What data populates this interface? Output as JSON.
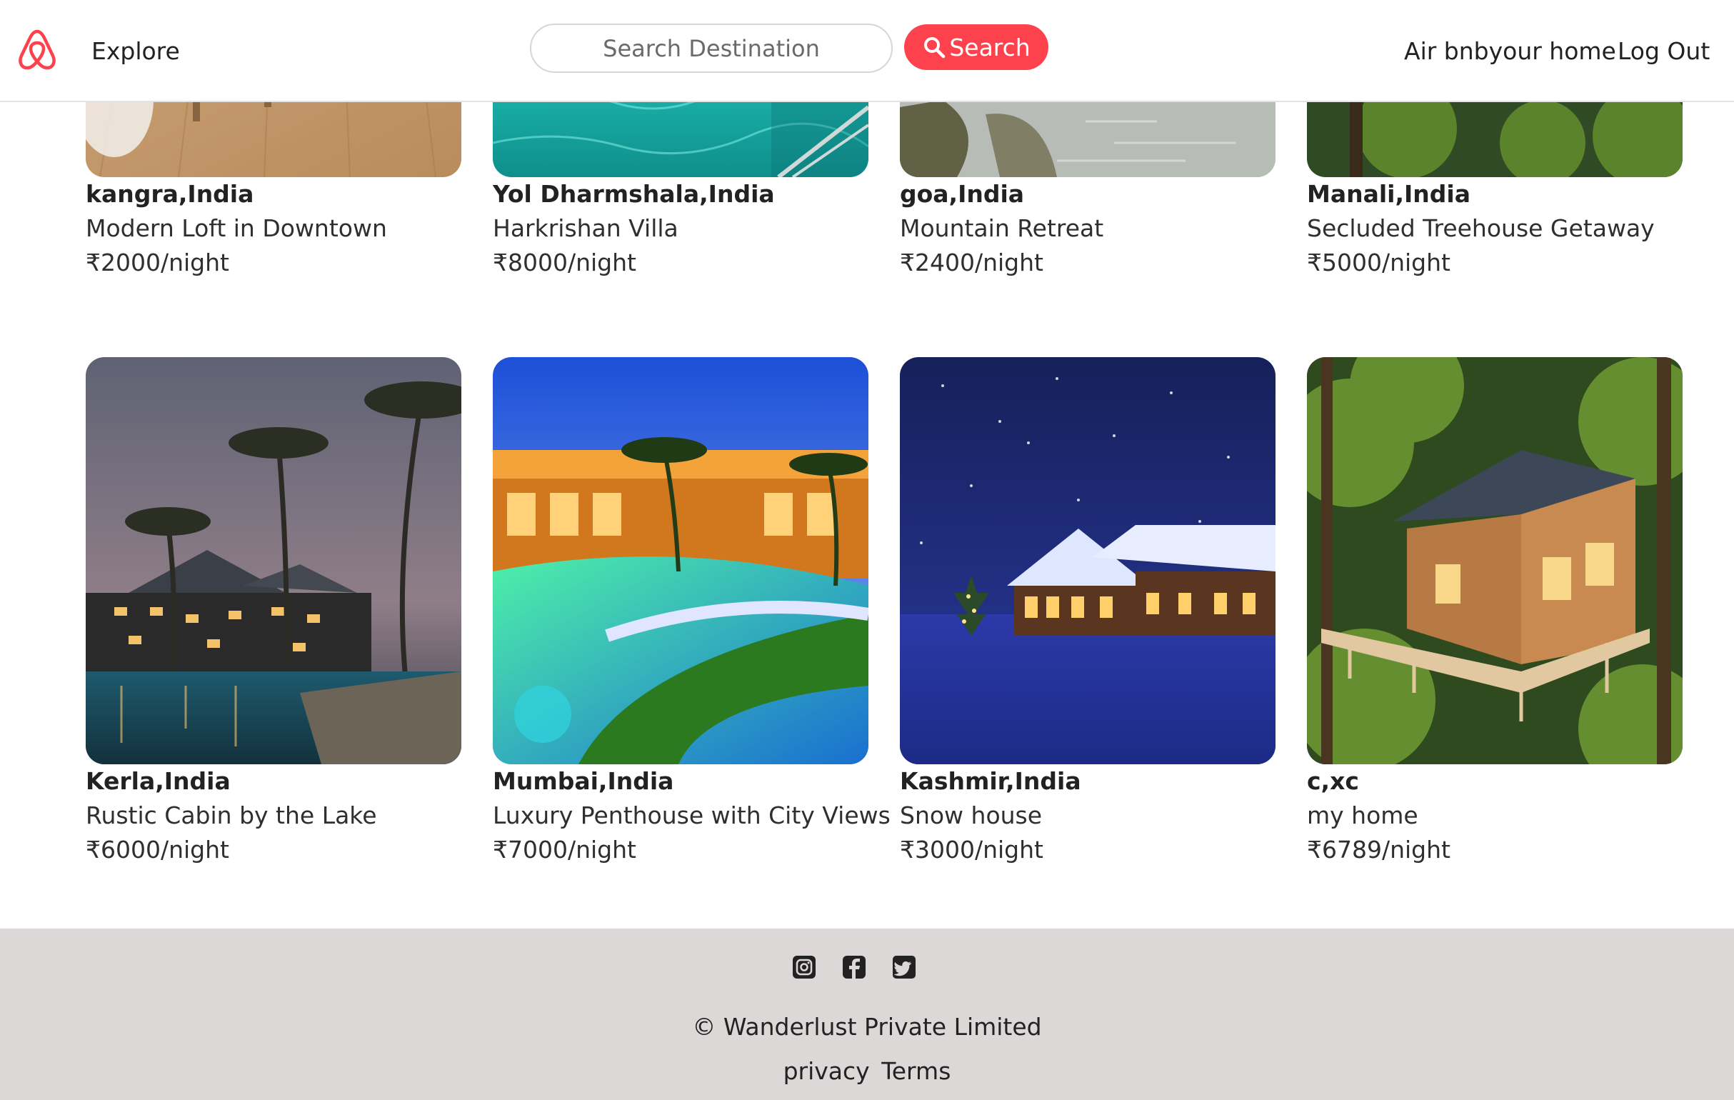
{
  "navbar": {
    "logo_icon": "airbnb-logo-icon",
    "explore": "Explore",
    "search_placeholder": "Search Destination",
    "search_button": "Search",
    "search_icon": "magnifier-icon",
    "host_link": "Air bnbyour home",
    "logout_link": "Log Out"
  },
  "colors": {
    "accent": "#fe424d",
    "footer_bg": "#dcd8d8",
    "text": "#222222"
  },
  "listings": [
    {
      "location": "kangra,India",
      "title": "Modern Loft in Downtown",
      "price": "₹2000/night"
    },
    {
      "location": "Yol Dharmshala,India",
      "title": "Harkrishan Villa",
      "price": "₹8000/night"
    },
    {
      "location": "goa,India",
      "title": "Mountain Retreat",
      "price": "₹2400/night"
    },
    {
      "location": "Manali,India",
      "title": "Secluded Treehouse Getaway",
      "price": "₹5000/night"
    },
    {
      "location": "Kerla,India",
      "title": "Rustic Cabin by the Lake",
      "price": "₹6000/night"
    },
    {
      "location": "Mumbai,India",
      "title": "Luxury Penthouse with City Views",
      "price": "₹7000/night"
    },
    {
      "location": "Kashmir,India",
      "title": "Snow house",
      "price": "₹3000/night"
    },
    {
      "location": "c,xc",
      "title": "my home",
      "price": "₹6789/night"
    }
  ],
  "footer": {
    "social_icons": [
      "instagram-icon",
      "facebook-icon",
      "twitter-icon"
    ],
    "copyright": "© Wanderlust Private Limited",
    "privacy": "privacy",
    "terms": "Terms"
  }
}
